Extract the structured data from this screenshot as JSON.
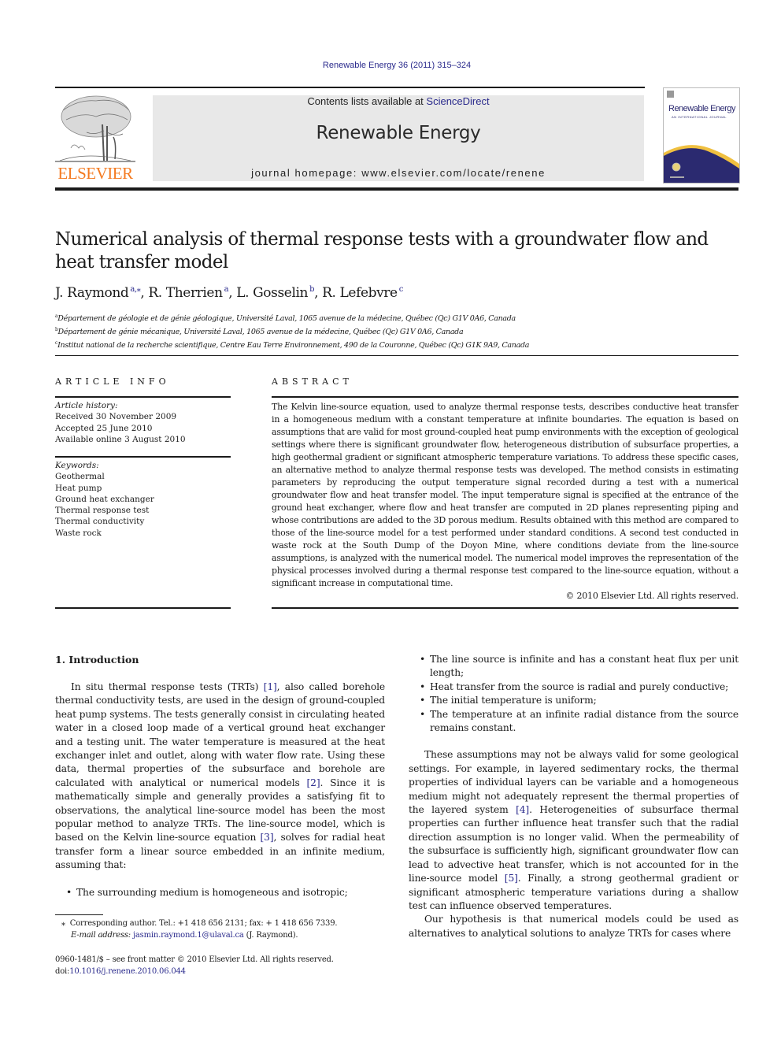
{
  "header": {
    "journal_citation": "Renewable Energy 36 (2011) 315–324",
    "contents_prefix": "Contents lists available at ",
    "contents_link": "ScienceDirect",
    "journal_name": "Renewable Energy",
    "homepage_prefix": "journal homepage: ",
    "homepage_url": "www.elsevier.com/locate/renene",
    "publisher_logo_text": "ELSEVIER",
    "cover_title": "Renewable Energy",
    "cover_subtitle": "AN INTERNATIONAL JOURNAL"
  },
  "article": {
    "title": "Numerical analysis of thermal response tests with a groundwater flow and heat transfer model",
    "authors": [
      {
        "name": "J. Raymond",
        "affil": "a,⁎",
        "sep": ", "
      },
      {
        "name": "R. Therrien",
        "affil": "a",
        "sep": ", "
      },
      {
        "name": "L. Gosselin",
        "affil": "b",
        "sep": ", "
      },
      {
        "name": "R. Lefebvre",
        "affil": "c",
        "sep": ""
      }
    ],
    "affiliations": [
      {
        "mark": "a",
        "text": "Département de géologie et de génie géologique, Université Laval, 1065 avenue de la médecine, Québec (Qc) G1V 0A6, Canada"
      },
      {
        "mark": "b",
        "text": "Département de génie mécanique, Université Laval, 1065 avenue de la médecine, Québec (Qc) G1V 0A6, Canada"
      },
      {
        "mark": "c",
        "text": "Institut national de la recherche scientifique, Centre Eau Terre Environnement, 490 de la Couronne, Québec (Qc) G1K 9A9, Canada"
      }
    ]
  },
  "article_info": {
    "heading": "ARTICLE INFO",
    "history_label": "Article history:",
    "received": "Received 30 November 2009",
    "accepted": "Accepted 25 June 2010",
    "online": "Available online 3 August 2010",
    "keywords_label": "Keywords:",
    "keywords": [
      "Geothermal",
      "Heat pump",
      "Ground heat exchanger",
      "Thermal response test",
      "Thermal conductivity",
      "Waste rock"
    ]
  },
  "abstract": {
    "heading": "ABSTRACT",
    "text": "The Kelvin line-source equation, used to analyze thermal response tests, describes conductive heat transfer in a homogeneous medium with a constant temperature at infinite boundaries. The equation is based on assumptions that are valid for most ground-coupled heat pump environments with the exception of geological settings where there is significant groundwater flow, heterogeneous distribution of subsurface properties, a high geothermal gradient or significant atmospheric temperature variations. To address these specific cases, an alternative method to analyze thermal response tests was developed. The method consists in estimating parameters by reproducing the output temperature signal recorded during a test with a numerical groundwater flow and heat transfer model. The input temperature signal is specified at the entrance of the ground heat exchanger, where flow and heat transfer are computed in 2D planes representing piping and whose contributions are added to the 3D porous medium. Results obtained with this method are compared to those of the line-source model for a test performed under standard conditions. A second test conducted in waste rock at the South Dump of the Doyon Mine, where conditions deviate from the line-source assumptions, is analyzed with the numerical model. The numerical model improves the representation of the physical processes involved during a thermal response test compared to the line-source equation, without a significant increase in computational time.",
    "copyright": "© 2010 Elsevier Ltd. All rights reserved."
  },
  "introduction": {
    "heading": "1.  Introduction",
    "p1_a": "In situ thermal response tests (TRTs) ",
    "ref1": "[1]",
    "p1_b": ", also called borehole thermal conductivity tests, are used in the design of ground-coupled heat pump systems. The tests generally consist in circulating heated water in a closed loop made of a vertical ground heat exchanger and a testing unit. The water temperature is measured at the heat exchanger inlet and outlet, along with water flow rate. Using these data, thermal properties of the subsurface and borehole are calculated with analytical or numerical models ",
    "ref2": "[2]",
    "p1_c": ". Since it is mathematically simple and generally provides a satisfying fit to observations, the analytical line-source model has been the most popular method to analyze TRTs. The line-source model, which is based on the Kelvin line-source equation ",
    "ref3": "[3]",
    "p1_d": ", solves for radial heat transfer form a linear source embedded in an infinite medium, assuming that:",
    "bullets": [
      "The surrounding medium is homogeneous and isotropic;",
      "The line source is infinite and has a constant heat flux per unit length;",
      "Heat transfer from the source is radial and purely conductive;",
      "The initial temperature is uniform;",
      "The temperature at an infinite radial distance from the source remains constant."
    ],
    "p2_a": "These assumptions may not be always valid for some geological settings. For example, in layered sedimentary rocks, the thermal properties of individual layers can be variable and a homogeneous medium might not adequately represent the thermal properties of the layered system ",
    "ref4": "[4]",
    "p2_b": ". Heterogeneities of subsurface thermal properties can further influence heat transfer such that the radial direction assumption is no longer valid. When the permeability of the subsurface is sufficiently high, significant groundwater flow can lead to advective heat transfer, which is not accounted for in the line-source model ",
    "ref5": "[5]",
    "p2_c": ". Finally, a strong geothermal gradient or significant atmospheric temperature variations during a shallow test can influence observed temperatures.",
    "p3": "Our hypothesis is that numerical models could be used as alternatives to analytical solutions to analyze TRTs for cases where"
  },
  "footnotes": {
    "star": "⁎",
    "corresponding": "Corresponding author. Tel.: +1 418 656 2131; fax: + 1 418 656 7339.",
    "email_label": "E-mail address: ",
    "email": "jasmin.raymond.1@ulaval.ca",
    "email_suffix": " (J. Raymond).",
    "issn_line": "0960-1481/$ – see front matter © 2010 Elsevier Ltd. All rights reserved.",
    "doi_label": "doi:",
    "doi": "10.1016/j.renene.2010.06.044"
  }
}
